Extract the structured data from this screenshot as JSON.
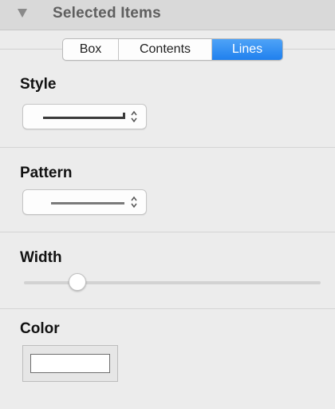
{
  "header": {
    "title": "Selected Items",
    "disclosure_icon": "disclosure-triangle-down-icon"
  },
  "tabs": [
    {
      "label": "Box",
      "selected": false
    },
    {
      "label": "Contents",
      "selected": false
    },
    {
      "label": "Lines",
      "selected": true
    }
  ],
  "sections": {
    "style": {
      "title": "Style",
      "value_icon": "solid-line-end-cap-icon"
    },
    "pattern": {
      "title": "Pattern",
      "value_icon": "solid-line-icon"
    },
    "width": {
      "title": "Width",
      "slider_value": 0.18
    },
    "color": {
      "title": "Color",
      "value": "#ffffff"
    }
  },
  "colors": {
    "accent": "#1f80ee",
    "panel_bg": "#ececec",
    "header_bg": "#d9d9d9"
  }
}
